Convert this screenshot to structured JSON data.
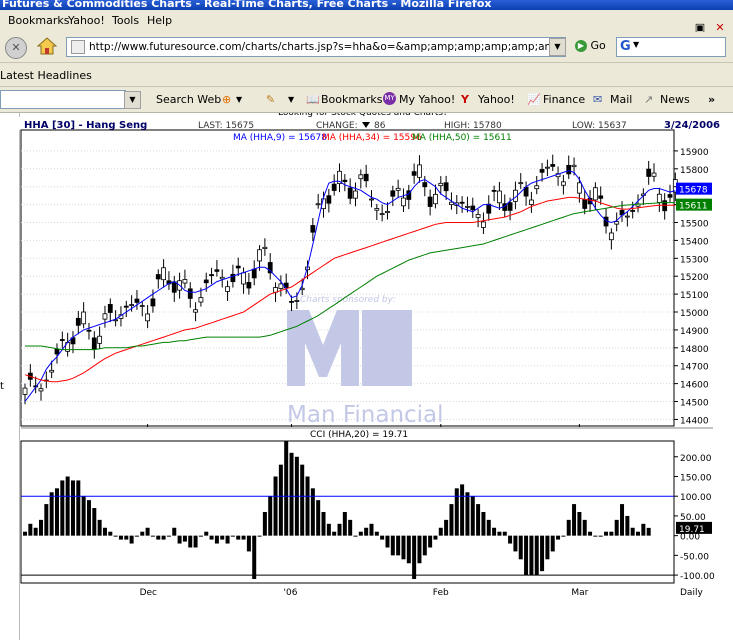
{
  "window": {
    "title": "Futures & Commodities Charts - Real-Time Charts, Free Charts - Mozilla Firefox"
  },
  "menu": {
    "bookmarks": "Bookmarks",
    "yahoo": "Yahoo!",
    "tools": "Tools",
    "help": "Help"
  },
  "nav": {
    "url": "http://www.futuresource.com/charts/charts.jsp?s=hha&o=&amp;amp;amp;amp;amp;amp;amp;amp;amp;a=",
    "go_label": "Go",
    "google_letter": "G"
  },
  "headlines": {
    "label": "Latest Headlines"
  },
  "toolbar": {
    "search_web": "Search Web",
    "bookmarks": "Bookmarks",
    "my_yahoo": "My Yahoo!",
    "yahoo": "Yahoo!",
    "finance": "Finance",
    "mail": "Mail",
    "news": "News",
    "more": "»"
  },
  "left_gutter": {
    "letter": "t"
  },
  "chart_header": {
    "symbol": "HHA [30] - Hang Seng",
    "last_label": "LAST:",
    "last": "15675",
    "change_label": "CHANGE:",
    "change": "86",
    "high_label": "HIGH:",
    "high": "15780",
    "low_label": "LOW:",
    "low": "15637",
    "date": "3/24/2006",
    "top_cut_text": "Looking for Stock Quotes and Charts?",
    "ma9_label": "MA (HHA,9) = 15678",
    "ma34_label": "MA (HHA,34) = 15596",
    "ma50_label": "MA (HHA,50) = 15611",
    "watermark_sponsor": "Charts sponsored by:",
    "watermark_brand": "Man Financial"
  },
  "cci_header": {
    "label": "CCI (HHA,20) = 19.71",
    "current": "19.71"
  },
  "bottom_label": "Daily",
  "colors": {
    "ma9": "#0000ff",
    "ma34": "#ff0000",
    "ma50": "#008000",
    "cci_ref": "#0000ff",
    "tag_ma9": "#0000ff",
    "tag_ma50": "#008000"
  },
  "chart_data": [
    {
      "type": "candlestick",
      "title": "HHA [30] - Hang Seng",
      "ylim": [
        14380,
        16000
      ],
      "y_ticks": [
        14400,
        14500,
        14600,
        14700,
        14800,
        14900,
        15000,
        15100,
        15200,
        15300,
        15400,
        15500,
        15600,
        15700,
        15800,
        15900
      ],
      "x_month_labels": [
        {
          "label": "Dec",
          "index": 23
        },
        {
          "label": "'06",
          "index": 50
        },
        {
          "label": "Feb",
          "index": 78
        },
        {
          "label": "Mar",
          "index": 104
        }
      ],
      "price_tags": [
        {
          "label": "15678",
          "value": 15678,
          "color": "#0000ff"
        },
        {
          "label": "15611",
          "value": 15611,
          "color": "#008000"
        }
      ],
      "series": [
        {
          "name": "MA (HHA,9)",
          "values": [
            14500,
            14540,
            14580,
            14620,
            14680,
            14720,
            14750,
            14790,
            14830,
            14860,
            14880,
            14900,
            14910,
            14920,
            14930,
            14940,
            14950,
            14960,
            14980,
            15000,
            15020,
            15040,
            15060,
            15080,
            15100,
            15120,
            15140,
            15160,
            15170,
            15150,
            15120,
            15110,
            15110,
            15120,
            15130,
            15150,
            15170,
            15180,
            15190,
            15200,
            15210,
            15220,
            15230,
            15240,
            15250,
            15250,
            15230,
            15200,
            15170,
            15130,
            15080,
            15090,
            15150,
            15250,
            15380,
            15510,
            15640,
            15720,
            15730,
            15730,
            15710,
            15700,
            15690,
            15680,
            15660,
            15640,
            15630,
            15610,
            15600,
            15620,
            15640,
            15650,
            15660,
            15700,
            15730,
            15740,
            15720,
            15700,
            15660,
            15640,
            15620,
            15600,
            15580,
            15570,
            15560,
            15580,
            15600,
            15600,
            15590,
            15580,
            15590,
            15620,
            15640,
            15670,
            15700,
            15720,
            15730,
            15740,
            15750,
            15760,
            15770,
            15780,
            15790,
            15780,
            15740,
            15680,
            15630,
            15580,
            15540,
            15510,
            15500,
            15510,
            15540,
            15560,
            15590,
            15620,
            15650,
            15680,
            15690,
            15690,
            15680,
            15670,
            15678
          ]
        },
        {
          "name": "MA (HHA,34)",
          "values": [
            14650,
            14640,
            14630,
            14620,
            14615,
            14610,
            14610,
            14615,
            14620,
            14630,
            14645,
            14660,
            14680,
            14700,
            14720,
            14740,
            14755,
            14770,
            14780,
            14790,
            14800,
            14810,
            14820,
            14830,
            14840,
            14850,
            14860,
            14870,
            14880,
            14890,
            14900,
            14905,
            14910,
            14920,
            14930,
            14940,
            14950,
            14960,
            14970,
            14980,
            14990,
            15000,
            15020,
            15040,
            15060,
            15080,
            15100,
            15110,
            15120,
            15130,
            15140,
            15160,
            15180,
            15200,
            15220,
            15240,
            15260,
            15280,
            15300,
            15310,
            15320,
            15330,
            15340,
            15350,
            15360,
            15370,
            15380,
            15390,
            15400,
            15410,
            15420,
            15430,
            15440,
            15450,
            15460,
            15470,
            15480,
            15490,
            15495,
            15500,
            15500,
            15500,
            15500,
            15500,
            15500,
            15505,
            15510,
            15515,
            15520,
            15525,
            15530,
            15540,
            15550,
            15560,
            15575,
            15590,
            15600,
            15610,
            15620,
            15625,
            15630,
            15635,
            15640,
            15640,
            15635,
            15630,
            15625,
            15620,
            15610,
            15600,
            15590,
            15580,
            15575,
            15575,
            15578,
            15582,
            15586,
            15590,
            15594,
            15596,
            15596,
            15596,
            15596
          ]
        },
        {
          "name": "MA (HHA,50)",
          "values": [
            14810,
            14810,
            14810,
            14810,
            14805,
            14800,
            14795,
            14790,
            14790,
            14790,
            14790,
            14790,
            14790,
            14790,
            14795,
            14800,
            14800,
            14800,
            14800,
            14800,
            14805,
            14810,
            14810,
            14815,
            14820,
            14825,
            14830,
            14830,
            14835,
            14840,
            14840,
            14845,
            14850,
            14855,
            14860,
            14860,
            14860,
            14860,
            14860,
            14860,
            14860,
            14860,
            14860,
            14860,
            14860,
            14865,
            14870,
            14880,
            14890,
            14900,
            14910,
            14920,
            14935,
            14950,
            14965,
            14980,
            15000,
            15020,
            15040,
            15060,
            15080,
            15100,
            15120,
            15140,
            15160,
            15180,
            15200,
            15215,
            15230,
            15245,
            15260,
            15275,
            15290,
            15300,
            15310,
            15320,
            15330,
            15335,
            15340,
            15345,
            15350,
            15355,
            15360,
            15365,
            15370,
            15375,
            15380,
            15390,
            15400,
            15410,
            15420,
            15430,
            15440,
            15450,
            15460,
            15470,
            15480,
            15490,
            15500,
            15510,
            15520,
            15530,
            15540,
            15550,
            15555,
            15560,
            15565,
            15570,
            15575,
            15580,
            15585,
            15590,
            15595,
            15598,
            15600,
            15602,
            15604,
            15606,
            15608,
            15610,
            15611,
            15611,
            15611
          ]
        }
      ]
    },
    {
      "type": "bar",
      "title": "CCI (HHA,20) = 19.71",
      "ylim": [
        -115,
        240
      ],
      "y_ticks": [
        200,
        150,
        100,
        50,
        0,
        -50,
        -100
      ],
      "reference_line": 100,
      "values": [
        10,
        30,
        20,
        40,
        80,
        110,
        120,
        140,
        150,
        140,
        140,
        100,
        90,
        70,
        40,
        20,
        10,
        0,
        -10,
        -10,
        -20,
        0,
        10,
        20,
        0,
        -10,
        -10,
        0,
        20,
        -20,
        -15,
        -30,
        -30,
        0,
        10,
        -10,
        -20,
        -10,
        -20,
        0,
        -10,
        -10,
        -40,
        -110,
        0,
        60,
        100,
        150,
        180,
        240,
        210,
        200,
        180,
        150,
        120,
        90,
        60,
        30,
        10,
        30,
        60,
        40,
        0,
        10,
        20,
        30,
        10,
        -10,
        -30,
        -50,
        -50,
        -60,
        -70,
        -110,
        -70,
        -50,
        -30,
        -10,
        20,
        40,
        80,
        120,
        130,
        110,
        100,
        80,
        60,
        40,
        20,
        10,
        10,
        -20,
        -40,
        -60,
        -100,
        -100,
        -100,
        -90,
        -60,
        -40,
        -10,
        0,
        40,
        80,
        60,
        40,
        10,
        0,
        0,
        10,
        10,
        40,
        80,
        50,
        20,
        10,
        30,
        19.71
      ]
    }
  ]
}
